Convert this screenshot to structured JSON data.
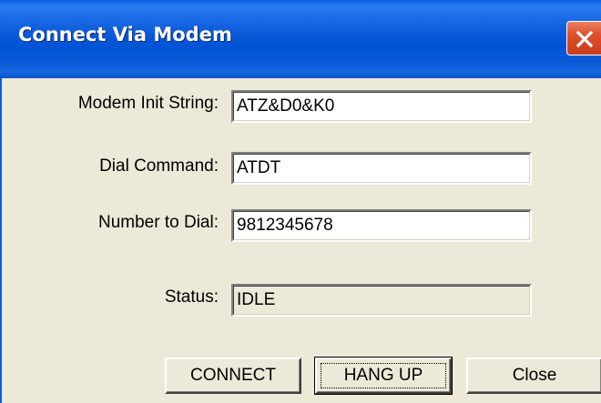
{
  "window": {
    "title": "Connect Via Modem"
  },
  "icons": {
    "close": "close-icon"
  },
  "fields": {
    "init_label": "Modem Init String:",
    "init_value": "ATZ&D0&K0",
    "dial_label": "Dial Command:",
    "dial_value": "ATDT",
    "number_label": "Number to Dial:",
    "number_value": "9812345678",
    "status_label": "Status:",
    "status_value": "IDLE"
  },
  "buttons": {
    "connect": "CONNECT",
    "hangup": "HANG UP",
    "close": "Close"
  },
  "colors": {
    "titlebar": "#0054d6",
    "close_button": "#e0502c",
    "dialog_background": "#ece9d8"
  }
}
